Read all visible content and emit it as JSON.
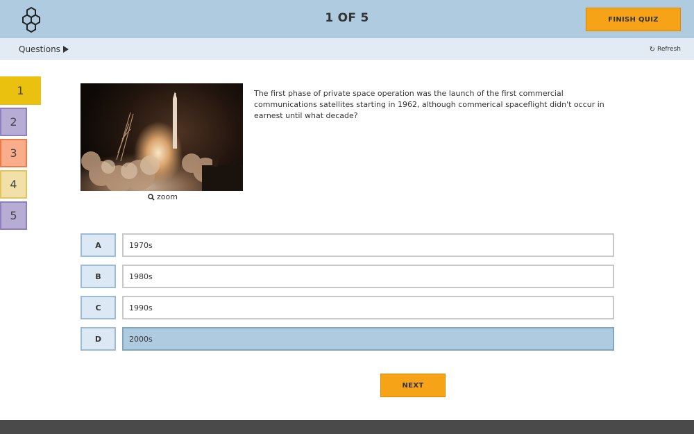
{
  "header": {
    "counter": "1 OF 5",
    "finish_label": "FINISH QUIZ",
    "logo_icon": "hexagon-molecule-icon"
  },
  "subbar": {
    "questions_label": "Questions",
    "refresh_label": "Refresh"
  },
  "question_nav": [
    {
      "label": "1",
      "color": "#e9c10e",
      "active": true
    },
    {
      "label": "2",
      "color": "#b7acd3",
      "border": "#8e80bf"
    },
    {
      "label": "3",
      "color": "#f9ad8a",
      "border": "#ee7a45"
    },
    {
      "label": "4",
      "color": "#f1e1a9",
      "border": "#e3c45a"
    },
    {
      "label": "5",
      "color": "#b7acd3",
      "border": "#8e80bf"
    }
  ],
  "question": {
    "text": "The first phase of private space operation was the launch of the first commercial communications satellites starting in 1962, although commerical spaceflight didn't occur in earnest until what decade?",
    "zoom_label": "zoom"
  },
  "answers": [
    {
      "letter": "A",
      "text": "1970s",
      "selected": false
    },
    {
      "letter": "B",
      "text": "1980s",
      "selected": false
    },
    {
      "letter": "C",
      "text": "1990s",
      "selected": false
    },
    {
      "letter": "D",
      "text": "2000s",
      "selected": true
    }
  ],
  "next_label": "NEXT",
  "colors": {
    "accent": "#f7a318",
    "header_bg": "#aecbe0",
    "subbar_bg": "#e2ebf3",
    "selected_answer": "#aecbe0"
  }
}
